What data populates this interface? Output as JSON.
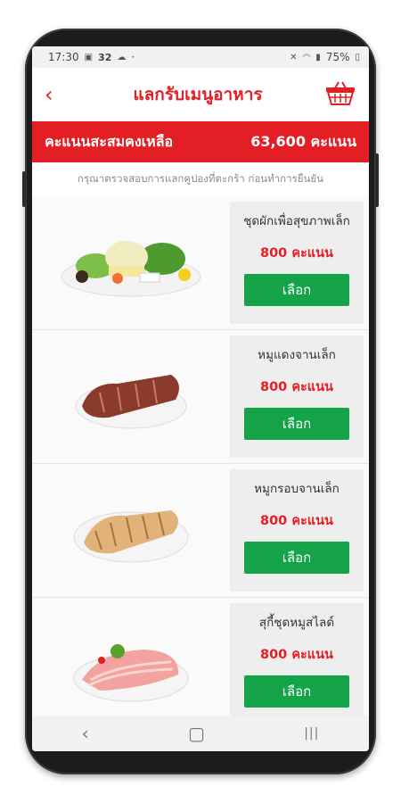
{
  "status_bar": {
    "time": "17:30",
    "notif_count": "32",
    "dot": "·",
    "battery": "75%",
    "icons": [
      "gallery-icon",
      "cloud-icon",
      "mute-icon",
      "wifi-icon",
      "signal-icon",
      "battery-icon"
    ]
  },
  "header": {
    "back_label": "‹",
    "title": "แลกรับเมนูอาหาร",
    "basket_icon": "basket-icon"
  },
  "points": {
    "label": "คะแนนสะสมคงเหลือ",
    "value": "63,600 คะแนน"
  },
  "notice": "กรุณาตรวจสอบการแลกคูปองที่ตะกร้า ก่อนทำการยืนยัน",
  "menu_items": [
    {
      "name": "ชุดผักเพื่อสุขภาพเล็ก",
      "price": "800  คะแนน",
      "button": "เลือก"
    },
    {
      "name": "หมูแดงจานเล็ก",
      "price": "800  คะแนน",
      "button": "เลือก"
    },
    {
      "name": "หมูกรอบจานเล็ก",
      "price": "800  คะแนน",
      "button": "เลือก"
    },
    {
      "name": "สุกี้ชุดหมูสไลด์",
      "price": "800  คะแนน",
      "button": "เลือก"
    }
  ],
  "nav": {
    "back": "‹",
    "home": "▢",
    "recents": "|||"
  },
  "colors": {
    "brand_red": "#e31e24",
    "button_green": "#15a34a"
  }
}
